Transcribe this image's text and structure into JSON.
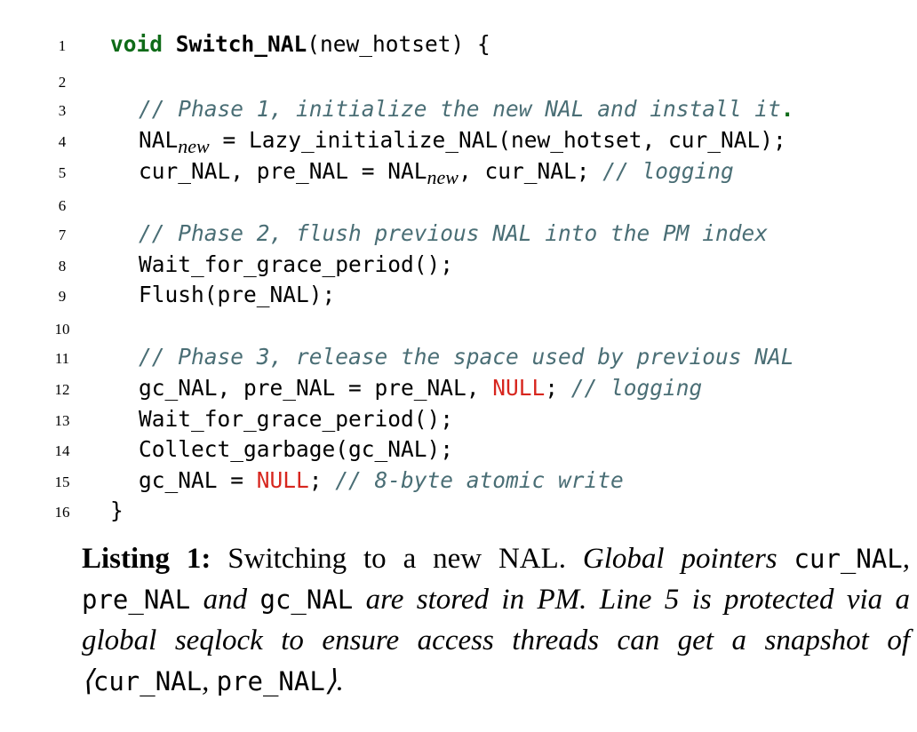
{
  "listing": {
    "line_numbers": [
      "1",
      "2",
      "3",
      "4",
      "5",
      "6",
      "7",
      "8",
      "9",
      "10",
      "11",
      "12",
      "13",
      "14",
      "15",
      "16"
    ],
    "l1": {
      "kw": "void",
      "fn": "Switch_NAL",
      "rest": "(new_hotset) {"
    },
    "l3": {
      "comment": "// Phase 1, initialize the new NAL and install it",
      "dot": "."
    },
    "l4": {
      "a": "NAL",
      "sub": "new",
      "b": " = Lazy_initialize_NAL(new_hotset, cur_NAL);"
    },
    "l5": {
      "a": "cur_NAL, pre_NAL = NAL",
      "sub": "new",
      "b": ", cur_NAL; ",
      "comment": "// logging"
    },
    "l7": {
      "comment": "// Phase 2, flush previous NAL into the PM index"
    },
    "l8": {
      "text": "Wait_for_grace_period();"
    },
    "l9": {
      "text": "Flush(pre_NAL);"
    },
    "l11": {
      "comment": "// Phase 3, release the space used by previous NAL"
    },
    "l12": {
      "a": "gc_NAL, pre_NAL = pre_NAL, ",
      "null": "NULL",
      "b": "; ",
      "comment": "// logging"
    },
    "l13": {
      "text": "Wait_for_grace_period();"
    },
    "l14": {
      "text": "Collect_garbage(gc_NAL);"
    },
    "l15": {
      "a": "gc_NAL = ",
      "null": "NULL",
      "b": "; ",
      "comment": "// 8-byte atomic write"
    },
    "l16": {
      "text": "}"
    }
  },
  "caption": {
    "label": "Listing 1:",
    "title": " Switching to a new NAL. ",
    "p1": "Global pointers ",
    "m1": "cur_NAL",
    "p2": ", ",
    "m2": "pre_NAL",
    "p3": " and ",
    "m3": "gc_NAL",
    "p4": " are stored in PM. Line 5 is protected via a global seqlock to ensure access threads can get a snapshot of ⟨",
    "m4": "cur_NAL",
    "p5": ", ",
    "m5": "pre_NAL",
    "p6": "⟩."
  }
}
